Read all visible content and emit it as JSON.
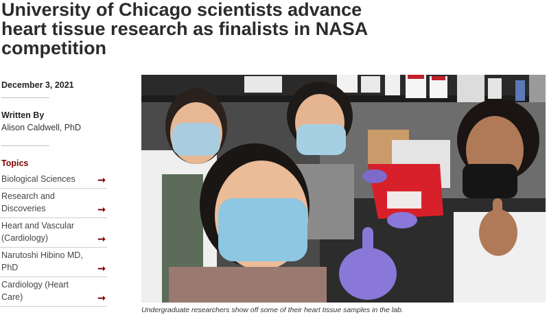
{
  "article": {
    "title": "University of Chicago scientists advance heart tissue research as finalists in NASA competition",
    "date": "December 3, 2021",
    "written_by_label": "Written By",
    "author": "Alison Caldwell, PhD"
  },
  "topics": {
    "heading": "Topics",
    "items": [
      {
        "label": "Biological Sciences"
      },
      {
        "label": "Research and Discoveries"
      },
      {
        "label": "Heart and Vascular (Cardiology)"
      },
      {
        "label": "Narutoshi Hibino MD, PhD"
      },
      {
        "label": "Cardiology (Heart Care)"
      }
    ],
    "arrow_icon": "right-arrow-icon"
  },
  "photo": {
    "caption": "Undergraduate researchers show off some of their heart tissue samples in the lab."
  },
  "colors": {
    "accent": "#800000",
    "text": "#2b2b2b",
    "divider": "#cfcfcf"
  }
}
